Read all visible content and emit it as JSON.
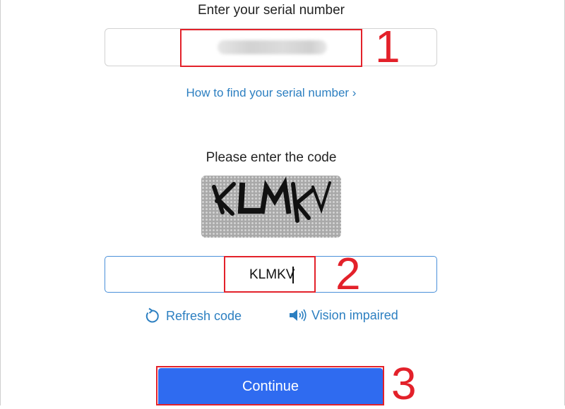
{
  "serial_section": {
    "title": "Enter your serial number",
    "link": "How to find your serial number ›"
  },
  "code_section": {
    "title": "Please enter the code",
    "captcha_text": "KLMKV",
    "input_value": "KLMKV",
    "refresh_label": "Refresh code",
    "vision_label": "Vision impaired"
  },
  "continue_label": "Continue",
  "annotations": {
    "step1": "1",
    "step2": "2",
    "step3": "3"
  },
  "colors": {
    "link": "#2c7fc1",
    "button": "#2f6bf0",
    "highlight": "#e3212a"
  }
}
